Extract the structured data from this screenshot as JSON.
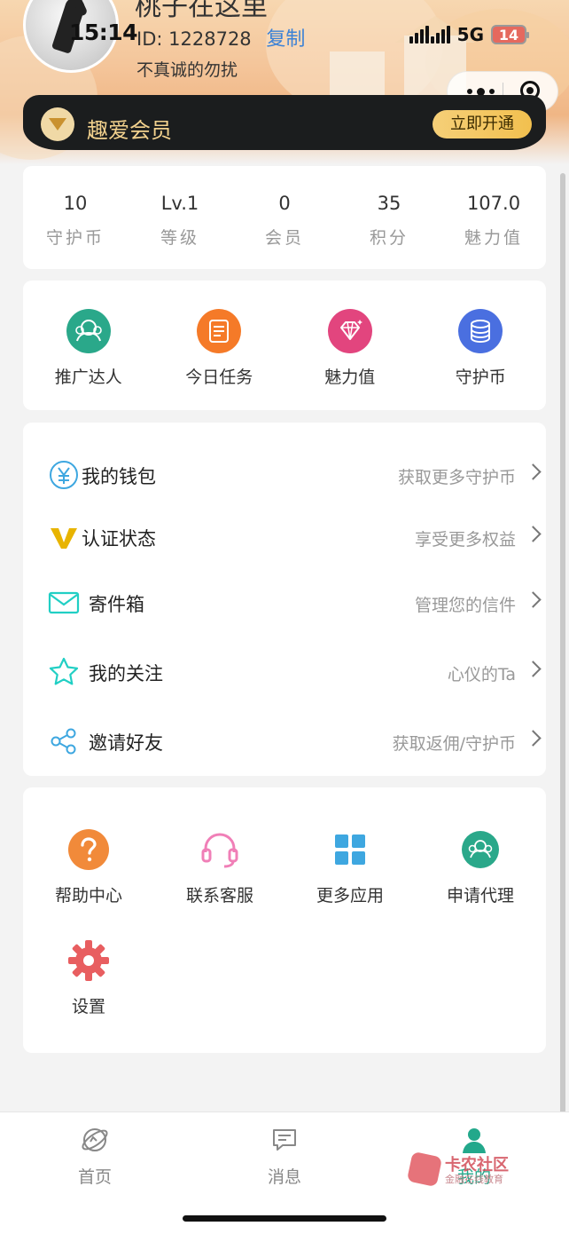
{
  "header": {
    "nickname": "桃子在这里",
    "status_time": "15:14",
    "id_label": "ID:",
    "id_value": "1228728",
    "copy_label": "复制",
    "signature": "不真诚的勿扰",
    "network": "5G",
    "battery": "14"
  },
  "vip": {
    "title": "趣爱会员",
    "action": "立即开通"
  },
  "stats": [
    {
      "value": "10",
      "label": "守护币"
    },
    {
      "value": "Lv.1",
      "label": "等级"
    },
    {
      "value": "0",
      "label": "会员"
    },
    {
      "value": "35",
      "label": "积分"
    },
    {
      "value": "107.0",
      "label": "魅力值"
    }
  ],
  "quick": [
    {
      "label": "推广达人",
      "icon": "people-icon",
      "color": "#2aa88a"
    },
    {
      "label": "今日任务",
      "icon": "task-list-icon",
      "color": "#f57a28"
    },
    {
      "label": "魅力值",
      "icon": "diamond-icon",
      "color": "#e2457e"
    },
    {
      "label": "守护币",
      "icon": "coin-stack-icon",
      "color": "#4a6fe0"
    }
  ],
  "menu": [
    {
      "label": "我的钱包",
      "hint": "获取更多守护币",
      "icon": "yuan-icon",
      "color": "#3ea7e0"
    },
    {
      "label": "认证状态",
      "hint": "享受更多权益",
      "icon": "v-badge-icon",
      "color": "#e8b400"
    },
    {
      "label": "寄件箱",
      "hint": "管理您的信件",
      "icon": "mail-icon",
      "color": "#21cfc4"
    },
    {
      "label": "我的关注",
      "hint": "心仪的Ta",
      "icon": "star-icon",
      "color": "#21cfc4"
    },
    {
      "label": "邀请好友",
      "hint": "获取返佣/守护币",
      "icon": "share-icon",
      "color": "#3ea7e0"
    }
  ],
  "tools": [
    {
      "label": "帮助中心",
      "icon": "question-icon",
      "color": "#f18a3a"
    },
    {
      "label": "联系客服",
      "icon": "headset-icon",
      "color": "#f07fb7"
    },
    {
      "label": "更多应用",
      "icon": "grid-icon",
      "color": "#3ea7e0"
    },
    {
      "label": "申请代理",
      "icon": "people-icon",
      "color": "#2aa88a"
    },
    {
      "label": "设置",
      "icon": "gear-icon",
      "color": "#e85e60"
    }
  ],
  "tabs": [
    {
      "label": "首页",
      "icon": "planet-icon"
    },
    {
      "label": "消息",
      "icon": "message-icon"
    },
    {
      "label": "我的",
      "icon": "profile-icon",
      "active": true
    }
  ],
  "watermark": {
    "title": "卡农社区",
    "subtitle": "金融在线教育"
  }
}
